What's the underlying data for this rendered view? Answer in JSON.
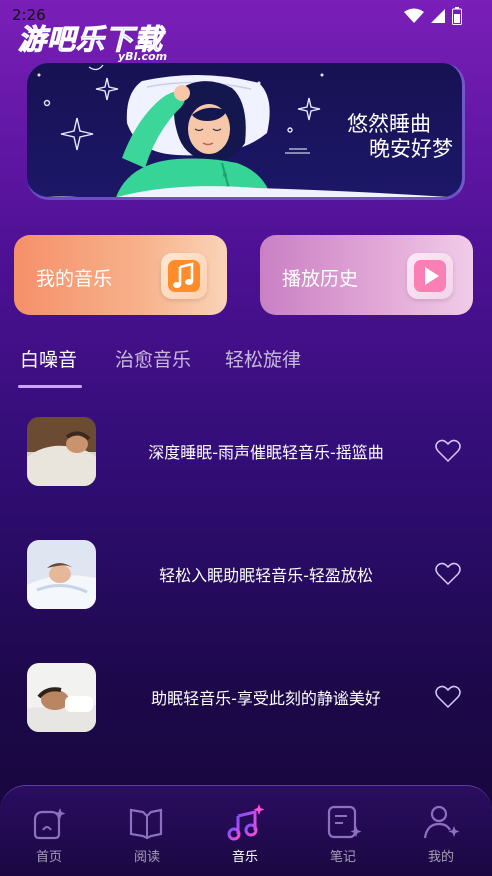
{
  "status_bar": {
    "time": "2:26",
    "icons": [
      "wifi-icon",
      "signal-icon",
      "battery-icon"
    ]
  },
  "watermark": {
    "title": "游吧乐下载",
    "sub": "yBl.com"
  },
  "banner": {
    "line1": "悠然睡曲",
    "line2": "晚安好梦"
  },
  "cards": [
    {
      "label": "我的音乐",
      "icon": "music-note-icon"
    },
    {
      "label": "播放历史",
      "icon": "play-icon"
    }
  ],
  "tabs": [
    {
      "label": "白噪音",
      "active": true
    },
    {
      "label": "治愈音乐",
      "active": false
    },
    {
      "label": "轻松旋律",
      "active": false
    }
  ],
  "tracks": [
    {
      "title": "深度睡眠-雨声催眠轻音乐-摇篮曲",
      "icon": "heart-icon"
    },
    {
      "title": "轻松入眠助眠轻音乐-轻盈放松",
      "icon": "heart-icon"
    },
    {
      "title": "助眠轻音乐-享受此刻的静谧美好",
      "icon": "heart-icon"
    }
  ],
  "nav": [
    {
      "label": "首页",
      "icon": "home-icon",
      "active": false
    },
    {
      "label": "阅读",
      "icon": "book-icon",
      "active": false
    },
    {
      "label": "音乐",
      "icon": "music-note-icon",
      "active": true
    },
    {
      "label": "笔记",
      "icon": "note-icon",
      "active": false
    },
    {
      "label": "我的",
      "icon": "user-icon",
      "active": false
    }
  ],
  "colors": {
    "accent": "#c7a8ff",
    "active_nav": "#b84cff",
    "bg_top": "#7a1fb8",
    "bg_bottom": "#16063a"
  }
}
